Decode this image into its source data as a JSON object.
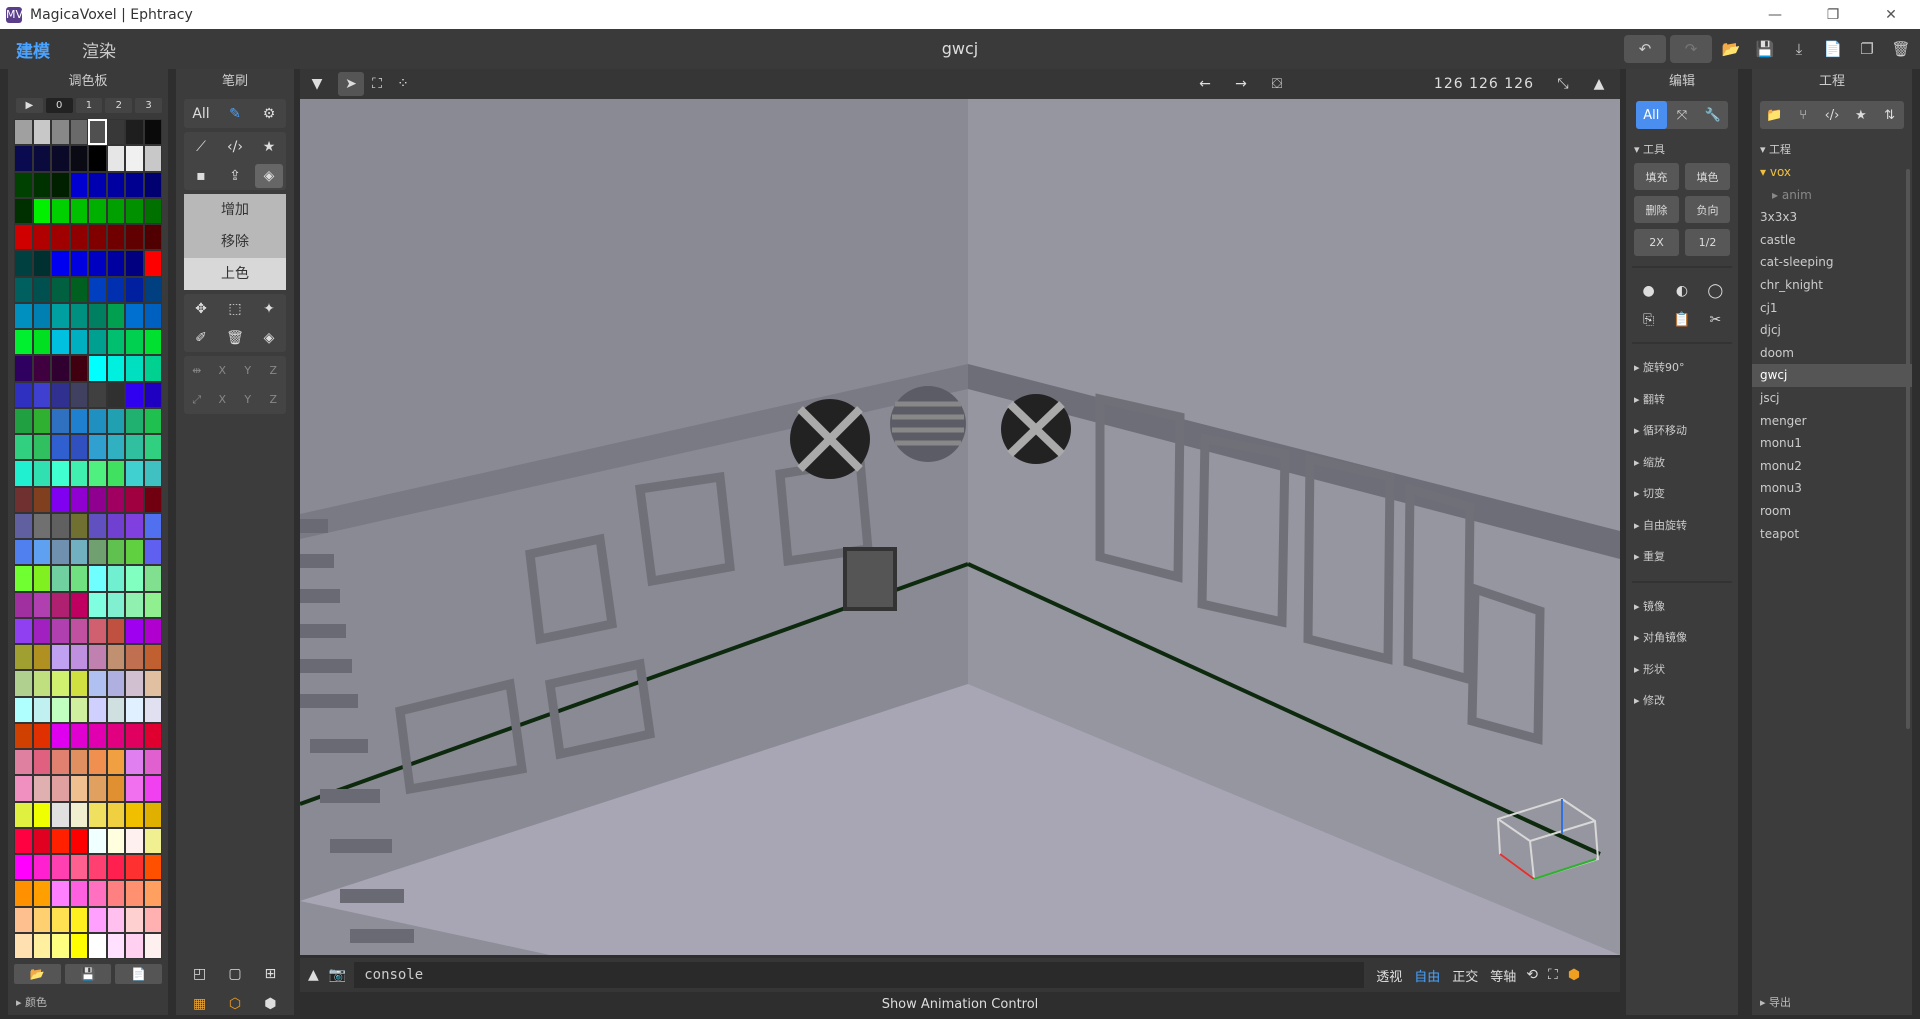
{
  "window": {
    "title": "MagicaVoxel | Ephtracy",
    "logo": "MV"
  },
  "window_controls": {
    "min": "—",
    "max": "❐",
    "close": "✕"
  },
  "menu": {
    "tabs": [
      "建模",
      "渲染"
    ],
    "file_name": "gwcj"
  },
  "top_actions": {
    "undo": "↶",
    "redo": "↷",
    "open": "📂",
    "save": "💾",
    "export": "⤓",
    "new": "📄",
    "copy": "❐",
    "delete": "🗑"
  },
  "palette": {
    "title": "调色板",
    "pages": [
      "▶",
      "0",
      "1",
      "2",
      "3"
    ],
    "footer_label": "颜色",
    "footer_icons": [
      "📂",
      "💾",
      "📄"
    ],
    "colors": [
      "#a0a0a0",
      "#c8c8c8",
      "#888888",
      "#6a6a6a",
      "#505050",
      "#383838",
      "#1e1e1e",
      "#0a0a0a",
      "#0a0a50",
      "#0a0a3c",
      "#0a0a28",
      "#0a0a14",
      "#000000",
      "#e6e6e6",
      "#f0f0f0",
      "#c8c8c8",
      "#004000",
      "#003200",
      "#002000",
      "#0000d0",
      "#0000b0",
      "#0000a0",
      "#000090",
      "#000070",
      "#003000",
      "#00f000",
      "#00d000",
      "#00c000",
      "#00b000",
      "#00a000",
      "#009000",
      "#007000",
      "#d00000",
      "#b00000",
      "#a00000",
      "#900000",
      "#800000",
      "#700000",
      "#600000",
      "#500000",
      "#004040",
      "#003030",
      "#0000f0",
      "#0000e0",
      "#0000c0",
      "#0000a0",
      "#000080",
      "#ff0000",
      "#006060",
      "#005050",
      "#006040",
      "#006020",
      "#0040c0",
      "#0030b0",
      "#0020a0",
      "#004080",
      "#0090c0",
      "#0080b0",
      "#00a0a0",
      "#009080",
      "#008060",
      "#00a050",
      "#0070d0",
      "#0060c0",
      "#00f030",
      "#00e020",
      "#00c0e0",
      "#00b0c0",
      "#00a090",
      "#00c070",
      "#00d050",
      "#00e030",
      "#300060",
      "#400040",
      "#300030",
      "#400010",
      "#00ffff",
      "#00f0e0",
      "#00e0c0",
      "#00d090",
      "#3030c0",
      "#4040d0",
      "#303090",
      "#404060",
      "#404040",
      "#303030",
      "#3000f0",
      "#2000c0",
      "#20a040",
      "#30b030",
      "#3070c0",
      "#2080d0",
      "#2090c0",
      "#20a0b0",
      "#20b070",
      "#20c050",
      "#30d080",
      "#30c060",
      "#3060d0",
      "#3050c0",
      "#30a0d0",
      "#30b0c0",
      "#30c0a0",
      "#30d080",
      "#20f0d0",
      "#30e0b0",
      "#40ffd0",
      "#40f0b0",
      "#50f080",
      "#40e060",
      "#40d0d0",
      "#40c0c0",
      "#703030",
      "#804020",
      "#8000f0",
      "#9000d0",
      "#900090",
      "#a00060",
      "#a00040",
      "#700010",
      "#6060a0",
      "#707070",
      "#606060",
      "#707030",
      "#6050c0",
      "#7040d0",
      "#8040e0",
      "#5070f0",
      "#5080f0",
      "#60a0f0",
      "#7090b0",
      "#70b0c0",
      "#70a070",
      "#60c050",
      "#60d040",
      "#6060f0",
      "#70ff30",
      "#80f020",
      "#70d0a0",
      "#70e080",
      "#70ffff",
      "#70f0d0",
      "#80ffc0",
      "#80e090",
      "#a030a0",
      "#b040b0",
      "#b02070",
      "#c00060",
      "#80ffe0",
      "#80f0d0",
      "#90f0b0",
      "#90f090",
      "#9040f0",
      "#a020c0",
      "#b040b0",
      "#c050a0",
      "#d06070",
      "#c05040",
      "#a000f0",
      "#b000d0",
      "#a0a030",
      "#b09020",
      "#c0a0f0",
      "#c090e0",
      "#c080b0",
      "#c09070",
      "#c07050",
      "#c06030",
      "#b0d090",
      "#c0e080",
      "#d0f070",
      "#d0e040",
      "#b0c0f0",
      "#b0b0e0",
      "#d0c0d0",
      "#e0c0a0",
      "#b0ffff",
      "#c0f0f0",
      "#c0ffc0",
      "#d0f0a0",
      "#d0d0ff",
      "#d0e0e0",
      "#e0f0ff",
      "#e0e0f0",
      "#d04000",
      "#e03000",
      "#e000f0",
      "#e000d0",
      "#e000b0",
      "#e00080",
      "#e00060",
      "#e00030",
      "#e080a0",
      "#e06080",
      "#e08070",
      "#e09060",
      "#f09050",
      "#f0a040",
      "#e080f0",
      "#e060d0",
      "#f090c0",
      "#e0b0b0",
      "#e0a0a0",
      "#f0c090",
      "#e0a060",
      "#e09030",
      "#f070f0",
      "#f040f0",
      "#e0f040",
      "#f0ff00",
      "#e0e0e0",
      "#f0f0d0",
      "#f0e060",
      "#f0d040",
      "#f0c000",
      "#e0b000",
      "#ff0040",
      "#e00020",
      "#ff2000",
      "#ff0000",
      "#f0ffff",
      "#ffffe0",
      "#fff0f0",
      "#f0f090",
      "#ff00ff",
      "#ff20d0",
      "#ff40b0",
      "#ff6090",
      "#ff4070",
      "#ff2050",
      "#ff3030",
      "#ff5000",
      "#ff9000",
      "#ffa000",
      "#ff80ff",
      "#ff60e0",
      "#ff70c0",
      "#ff8080",
      "#ff9070",
      "#ffa060",
      "#ffc090",
      "#ffd070",
      "#ffe050",
      "#fff020",
      "#ffa0ff",
      "#ffc0f0",
      "#ffd0d0",
      "#ffb0b0",
      "#ffe0b0",
      "#fff0a0",
      "#ffff80",
      "#ffff00",
      "#ffffff",
      "#ffe0ff",
      "#ffd0f0",
      "#fff0f0"
    ]
  },
  "brush": {
    "title": "笔刷",
    "filter": "All",
    "modes": [
      "增加",
      "移除",
      "上色"
    ],
    "axis_labels": [
      "X",
      "Y",
      "Z"
    ]
  },
  "viewport": {
    "dims": "126 126 126",
    "console": "console",
    "view_modes": [
      "透视",
      "自由",
      "正交",
      "等轴"
    ],
    "anim_label": "Show Animation Control",
    "bg": "#8e8e98"
  },
  "edit": {
    "title": "编辑",
    "filter": "All",
    "tools_header": "工具",
    "tools": [
      "填充",
      "填色",
      "删除",
      "负向",
      "2X",
      "1/2"
    ],
    "ops_a": [
      "旋转90°",
      "翻转",
      "循环移动",
      "缩放",
      "切变",
      "自由旋转",
      "重复"
    ],
    "ops_b": [
      "镜像",
      "对角镜像",
      "形状",
      "修改"
    ]
  },
  "project": {
    "title": "工程",
    "section": "工程",
    "folder": "vox",
    "sub": "anim",
    "files": [
      "3x3x3",
      "castle",
      "cat-sleeping",
      "chr_knight",
      "cj1",
      "djcj",
      "doom",
      "gwcj",
      "jscj",
      "menger",
      "monu1",
      "monu2",
      "monu3",
      "room",
      "teapot"
    ],
    "selected": "gwcj",
    "footer": "导出"
  }
}
